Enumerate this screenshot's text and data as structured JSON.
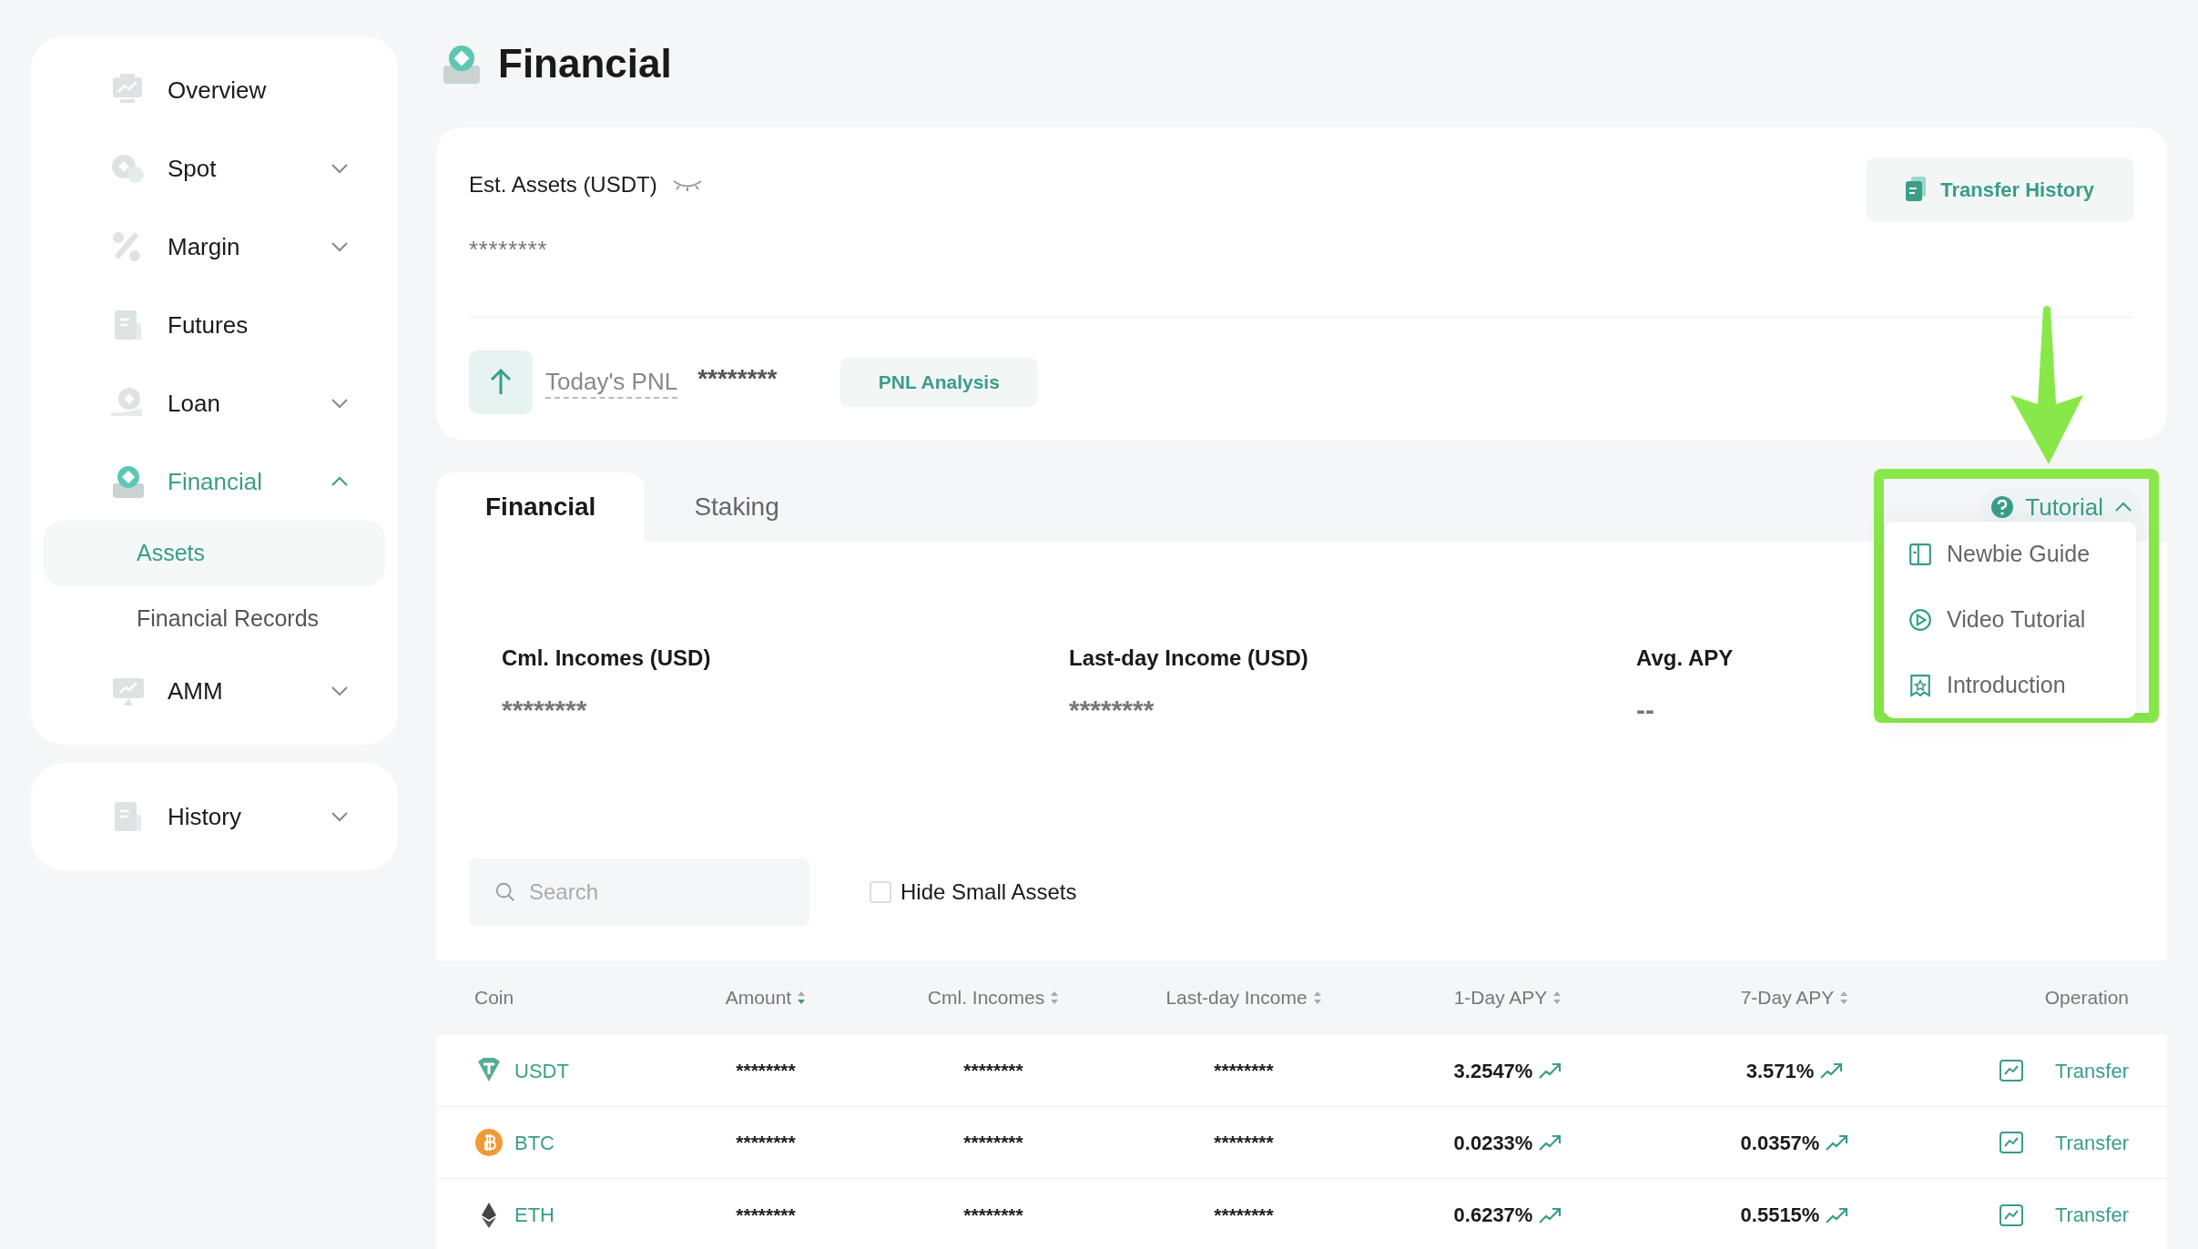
{
  "sidebar": {
    "groups": [
      {
        "items": [
          {
            "label": "Overview",
            "selected": false
          },
          {
            "label": "Spot",
            "expanded": false,
            "selected": false
          },
          {
            "label": "Margin",
            "expanded": false,
            "selected": false
          },
          {
            "label": "Futures",
            "selected": false
          },
          {
            "label": "Loan",
            "expanded": false,
            "selected": false
          },
          {
            "label": "Financial",
            "expanded": true,
            "selected": true,
            "children": [
              {
                "label": "Assets",
                "selected": true
              },
              {
                "label": "Financial Records",
                "selected": false
              }
            ]
          },
          {
            "label": "AMM",
            "expanded": false,
            "selected": false
          }
        ]
      },
      {
        "items": [
          {
            "label": "History",
            "expanded": false,
            "selected": false
          }
        ]
      }
    ]
  },
  "page_title": "Financial",
  "assets_card": {
    "label": "Est. Assets (USDT)",
    "value": "********",
    "transfer_button": "Transfer History",
    "pnl_label": "Today's PNL",
    "pnl_value": "********",
    "pnl_button": "PNL Analysis"
  },
  "tabs": [
    {
      "label": "Financial",
      "selected": true
    },
    {
      "label": "Staking",
      "selected": false
    }
  ],
  "tutorial": {
    "label": "Tutorial",
    "expanded": true,
    "items": [
      {
        "label": "Newbie Guide"
      },
      {
        "label": "Video Tutorial"
      },
      {
        "label": "Introduction"
      }
    ]
  },
  "stats": [
    {
      "label": "Cml. Incomes (USD)",
      "value": "********"
    },
    {
      "label": "Last-day Income (USD)",
      "value": "********"
    },
    {
      "label": "Avg. APY",
      "value": "--"
    }
  ],
  "search": {
    "placeholder": "Search"
  },
  "hide_small_assets": {
    "label": "Hide Small Assets",
    "checked": false
  },
  "table": {
    "columns": [
      {
        "label": "Coin"
      },
      {
        "label": "Amount",
        "sorted": true
      },
      {
        "label": "Cml. Incomes",
        "sorted": false
      },
      {
        "label": "Last-day Income",
        "sorted": false
      },
      {
        "label": "1-Day APY",
        "sorted": false
      },
      {
        "label": "7-Day APY",
        "sorted": false
      },
      {
        "label": "Operation"
      }
    ],
    "rows": [
      {
        "coin": "USDT",
        "amount": "********",
        "cml": "********",
        "last_day": "********",
        "apy_1d": "3.2547%",
        "apy_7d": "3.571%",
        "operation": "Transfer"
      },
      {
        "coin": "BTC",
        "amount": "********",
        "cml": "********",
        "last_day": "********",
        "apy_1d": "0.0233%",
        "apy_7d": "0.0357%",
        "operation": "Transfer"
      },
      {
        "coin": "ETH",
        "amount": "********",
        "cml": "********",
        "last_day": "********",
        "apy_1d": "0.6237%",
        "apy_7d": "0.5515%",
        "operation": "Transfer"
      }
    ]
  }
}
